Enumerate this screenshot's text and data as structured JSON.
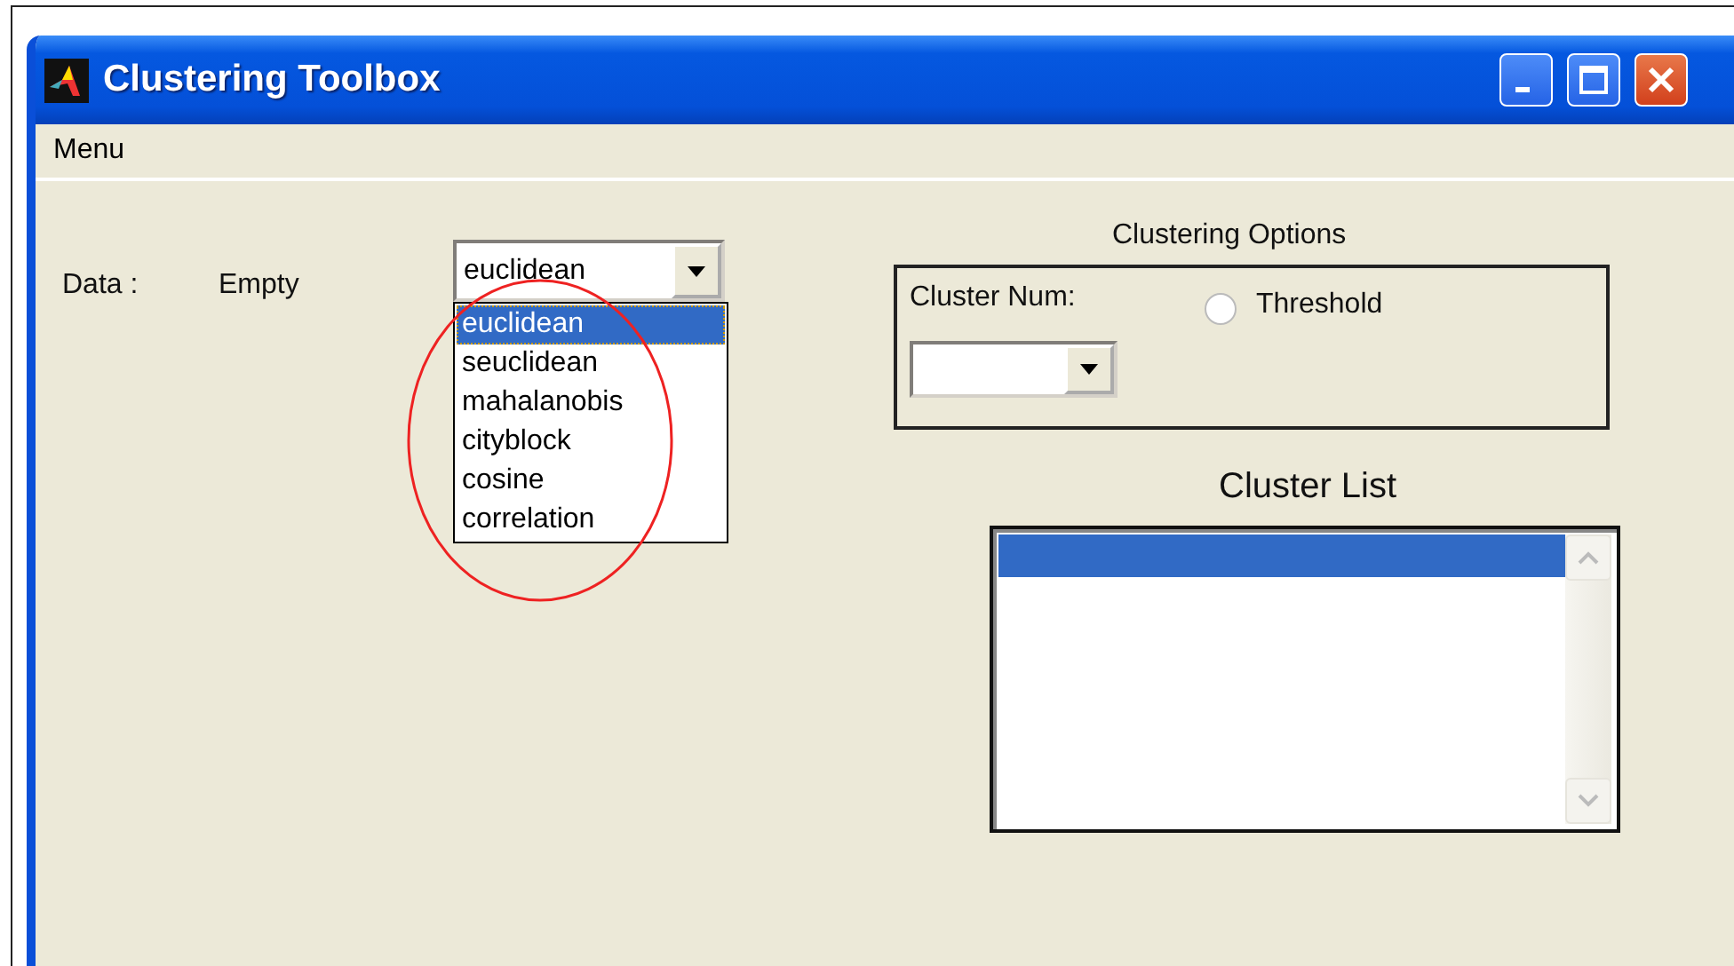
{
  "window": {
    "title": "Clustering Toolbox"
  },
  "menu": [
    {
      "label": "Menu"
    }
  ],
  "data_label": "Data :",
  "data_value": "Empty",
  "distance_popup": {
    "value": "euclidean",
    "expanded": true,
    "options": [
      {
        "label": "euclidean",
        "selected": true
      },
      {
        "label": "seuclidean",
        "selected": false
      },
      {
        "label": "mahalanobis",
        "selected": false
      },
      {
        "label": "cityblock",
        "selected": false
      },
      {
        "label": "cosine",
        "selected": false
      },
      {
        "label": "correlation",
        "selected": false
      }
    ]
  },
  "clustering_options": {
    "title": "Clustering Options",
    "cluster_num_label": "Cluster Num:",
    "threshold": {
      "label": "Threshold",
      "selected": false
    }
  },
  "cluster_list": {
    "title": "Cluster List",
    "items": [
      {
        "selected": true
      }
    ]
  }
}
